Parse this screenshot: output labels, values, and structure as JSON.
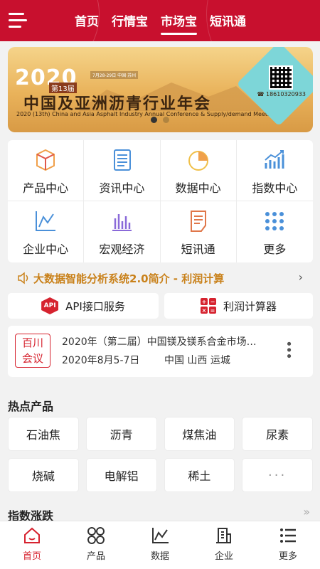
{
  "header": {
    "tabs": [
      {
        "label": "首页"
      },
      {
        "label": "行情宝"
      },
      {
        "label": "市场宝",
        "active": true
      },
      {
        "label": "短讯通"
      }
    ]
  },
  "banner": {
    "year": "2020",
    "edition": "第13届",
    "title_cn": "中国及亚洲沥青行业年会",
    "subtitle_en": "2020 (13th) China and Asia Asphalt Industry Annual Conference & Supply/demand Meeting",
    "dates": "7月28-29日  中国·苏州",
    "phone": "18610320933",
    "page_index": 0,
    "page_count": 2
  },
  "grid": {
    "items": [
      {
        "label": "产品中心",
        "icon": "cube-icon"
      },
      {
        "label": "资讯中心",
        "icon": "document-icon"
      },
      {
        "label": "数据中心",
        "icon": "pie-chart-icon"
      },
      {
        "label": "指数中心",
        "icon": "bar-trend-icon"
      },
      {
        "label": "企业中心",
        "icon": "line-chart-icon"
      },
      {
        "label": "宏观经济",
        "icon": "bar-chart-icon"
      },
      {
        "label": "短讯通",
        "icon": "note-icon"
      },
      {
        "label": "更多",
        "icon": "dots-grid-icon"
      }
    ]
  },
  "notice": {
    "text": "大数据智能分析系统2.0简介 - 利润计算"
  },
  "services": {
    "api_label": "API接口服务",
    "api_badge": "API",
    "calc_label": "利润计算器",
    "calc_symbols": [
      "+",
      "−",
      "×",
      "="
    ]
  },
  "meeting": {
    "badge_line1": "百川",
    "badge_line2": "会议",
    "title": "2020年（第二届）中国镁及镁系合金市场…",
    "date": "2020年8月5-7日",
    "location": "中国 山西 运城"
  },
  "hot_products": {
    "title": "热点产品",
    "items": [
      "石油焦",
      "沥青",
      "煤焦油",
      "尿素",
      "烧碱",
      "电解铝",
      "稀土",
      "···"
    ]
  },
  "index_section": {
    "title": "指数涨跌"
  },
  "bottom_nav": {
    "items": [
      {
        "label": "首页",
        "icon": "home-icon",
        "active": true
      },
      {
        "label": "产品",
        "icon": "grid-circles-icon"
      },
      {
        "label": "数据",
        "icon": "chart-icon"
      },
      {
        "label": "企业",
        "icon": "building-icon"
      },
      {
        "label": "更多",
        "icon": "list-icon"
      }
    ]
  },
  "colors": {
    "brand_red": "#c8102e",
    "notice_orange": "#c9811a",
    "icon_blue": "#4a90d9",
    "icon_orange": "#f0a04a"
  }
}
